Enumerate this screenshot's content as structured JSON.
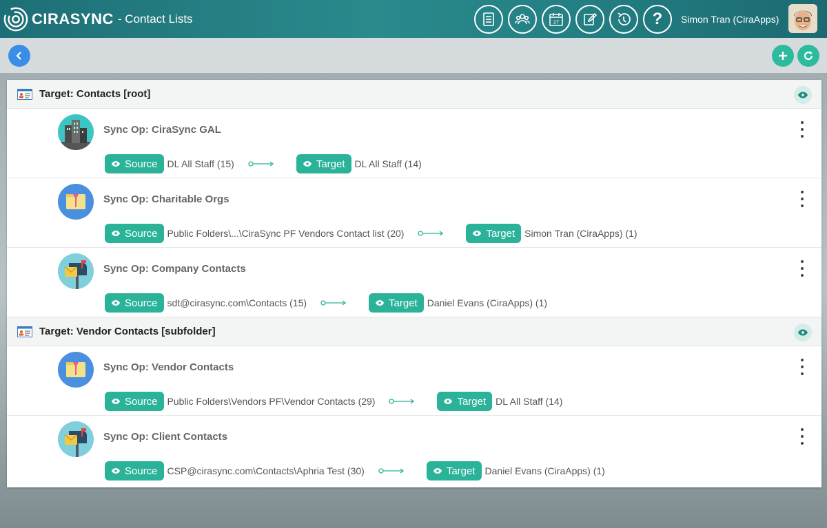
{
  "header": {
    "brand": "CIRASYNC",
    "page_title": "- Contact Lists",
    "user_name": "Simon Tran (CiraApps)",
    "nav_icons": [
      "document-list-icon",
      "users-icon",
      "calendar-icon",
      "edit-icon",
      "history-icon",
      "help-icon"
    ],
    "calendar_day": "27",
    "help_glyph": "?"
  },
  "colors": {
    "header_teal": "#237f83",
    "accent_green": "#2bb39a",
    "back_blue": "#3a8ee6"
  },
  "groups": [
    {
      "title": "Target: Contacts [root]",
      "ops": [
        {
          "title": "Sync Op: CiraSync GAL",
          "icon": "buildings-icon",
          "source_label": "Source",
          "source": "DL All Staff (15)",
          "target_label": "Target",
          "target": "DL All Staff (14)"
        },
        {
          "title": "Sync Op: Charitable Orgs",
          "icon": "folder-icon",
          "source_label": "Source",
          "source": "Public Folders\\...\\CiraSync PF Vendors Contact list (20)",
          "target_label": "Target",
          "target": "Simon Tran (CiraApps) (1)"
        },
        {
          "title": "Sync Op: Company Contacts",
          "icon": "mailbox-icon",
          "source_label": "Source",
          "source": "sdt@cirasync.com\\Contacts (15)",
          "target_label": "Target",
          "target": "Daniel Evans (CiraApps) (1)"
        }
      ]
    },
    {
      "title": "Target: Vendor Contacts [subfolder]",
      "ops": [
        {
          "title": "Sync Op: Vendor Contacts",
          "icon": "folder-icon",
          "source_label": "Source",
          "source": "Public Folders\\Vendors PF\\Vendor Contacts (29)",
          "target_label": "Target",
          "target": "DL All Staff (14)"
        },
        {
          "title": "Sync Op: Client Contacts",
          "icon": "mailbox-icon",
          "source_label": "Source",
          "source": "CSP@cirasync.com\\Contacts\\Aphria Test (30)",
          "target_label": "Target",
          "target": "Daniel Evans (CiraApps) (1)"
        }
      ]
    }
  ]
}
